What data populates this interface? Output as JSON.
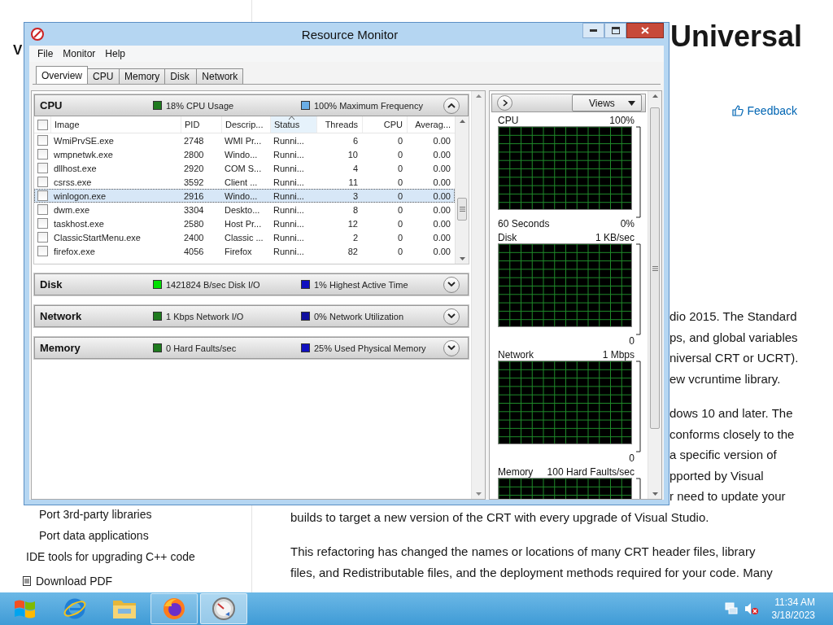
{
  "browser_page": {
    "left_heading": "V",
    "heading": "Universal",
    "feedback": "Feedback",
    "fragments_1": [
      "dio 2015. The Standard",
      "ps, and global variables",
      "niversal CRT or UCRT).",
      "ew vcruntime library."
    ],
    "fragments_2": [
      "dows 10 and later. The",
      "conforms closely to the",
      "a specific version of",
      "pported by Visual",
      "r need to update your"
    ],
    "lines_1": [
      "builds to target a new version of the CRT with every upgrade of Visual Studio."
    ],
    "lines_2": [
      "This refactoring has changed the names or locations of many CRT header files, library",
      "files, and Redistributable files, and the deployment methods required for your code. Many"
    ],
    "sidebar_items": [
      "Port 3rd-party libraries",
      "Port data applications",
      "IDE tools for upgrading C++ code"
    ],
    "download": "Download PDF"
  },
  "window": {
    "title": "Resource Monitor",
    "menu": [
      "File",
      "Monitor",
      "Help"
    ],
    "tabs": [
      {
        "label": "Overview",
        "selected": true
      },
      {
        "label": "CPU",
        "selected": false
      },
      {
        "label": "Memory",
        "selected": false
      },
      {
        "label": "Disk",
        "selected": false
      },
      {
        "label": "Network",
        "selected": false
      }
    ],
    "sections": [
      {
        "title": "CPU",
        "expanded": true,
        "stats": [
          {
            "text": "18% CPU Usage",
            "color": "#1e7a1e"
          },
          {
            "text": "100% Maximum Frequency",
            "color": "#6aaee6"
          }
        ],
        "table": {
          "all_checked": false,
          "columns": [
            {
              "label": "Image",
              "sorted": false
            },
            {
              "label": "PID",
              "sorted": false
            },
            {
              "label": "Descrip...",
              "sorted": false
            },
            {
              "label": "Status",
              "sorted": true
            },
            {
              "label": "Threads",
              "sorted": false
            },
            {
              "label": "CPU",
              "sorted": false
            },
            {
              "label": "Averag...",
              "sorted": false
            }
          ],
          "rows": [
            {
              "checked": false,
              "selected": false,
              "cells": [
                "WmiPrvSE.exe",
                "2748",
                "WMI Pr...",
                "Runni...",
                "6",
                "0",
                "0.00"
              ]
            },
            {
              "checked": false,
              "selected": false,
              "cells": [
                "wmpnetwk.exe",
                "2800",
                "Windo...",
                "Runni...",
                "10",
                "0",
                "0.00"
              ]
            },
            {
              "checked": false,
              "selected": false,
              "cells": [
                "dllhost.exe",
                "2920",
                "COM S...",
                "Runni...",
                "4",
                "0",
                "0.00"
              ]
            },
            {
              "checked": false,
              "selected": false,
              "cells": [
                "csrss.exe",
                "3592",
                "Client ...",
                "Runni...",
                "11",
                "0",
                "0.00"
              ]
            },
            {
              "checked": false,
              "selected": true,
              "cells": [
                "winlogon.exe",
                "2916",
                "Windo...",
                "Runni...",
                "3",
                "0",
                "0.00"
              ]
            },
            {
              "checked": false,
              "selected": false,
              "cells": [
                "dwm.exe",
                "3304",
                "Deskto...",
                "Runni...",
                "8",
                "0",
                "0.00"
              ]
            },
            {
              "checked": false,
              "selected": false,
              "cells": [
                "taskhost.exe",
                "2580",
                "Host Pr...",
                "Runni...",
                "12",
                "0",
                "0.00"
              ]
            },
            {
              "checked": false,
              "selected": false,
              "cells": [
                "ClassicStartMenu.exe",
                "2400",
                "Classic ...",
                "Runni...",
                "2",
                "0",
                "0.00"
              ]
            },
            {
              "checked": false,
              "selected": false,
              "cells": [
                "firefox.exe",
                "4056",
                "Firefox",
                "Runni...",
                "82",
                "0",
                "0.00"
              ]
            }
          ]
        }
      },
      {
        "title": "Disk",
        "expanded": false,
        "stats": [
          {
            "text": "1421824 B/sec Disk I/O",
            "color": "#00e000"
          },
          {
            "text": "1% Highest Active Time",
            "color": "#1010c0"
          }
        ]
      },
      {
        "title": "Network",
        "expanded": false,
        "stats": [
          {
            "text": "1 Kbps Network I/O",
            "color": "#1e7a1e"
          },
          {
            "text": "0% Network Utilization",
            "color": "#1010a0"
          }
        ]
      },
      {
        "title": "Memory",
        "expanded": false,
        "stats": [
          {
            "text": "0 Hard Faults/sec",
            "color": "#1e7a1e"
          },
          {
            "text": "25% Used Physical Memory",
            "color": "#1010c0"
          }
        ]
      }
    ],
    "graphs_panel": {
      "views": "Views",
      "graphs": [
        {
          "label": "CPU",
          "max": "100%",
          "min": "0%",
          "footer": "60 Seconds"
        },
        {
          "label": "Disk",
          "max": "1 KB/sec",
          "min": "0"
        },
        {
          "label": "Network",
          "max": "1 Mbps",
          "min": "0"
        },
        {
          "label": "Memory",
          "max": "100 Hard Faults/sec"
        }
      ]
    }
  },
  "taskbar": {
    "apps": [
      {
        "kind": "ie",
        "open": false,
        "selected": false
      },
      {
        "kind": "explorer",
        "open": false,
        "selected": false
      },
      {
        "kind": "firefox",
        "open": true,
        "selected": false
      },
      {
        "kind": "resmon",
        "open": true,
        "selected": true
      }
    ],
    "time": "11:34 AM",
    "date": "3/18/2023"
  }
}
